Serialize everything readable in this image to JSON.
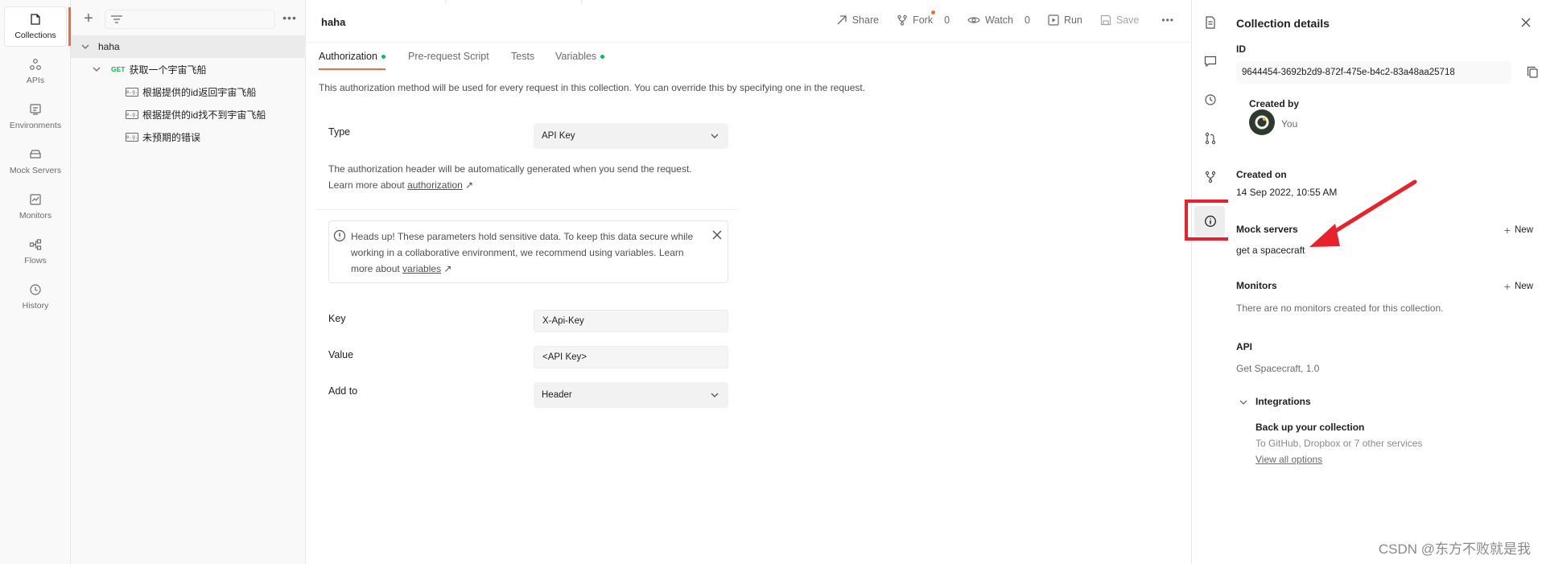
{
  "rail": {
    "items": [
      {
        "label": "Collections",
        "icon": "collections-icon"
      },
      {
        "label": "APIs",
        "icon": "apis-icon"
      },
      {
        "label": "Environments",
        "icon": "environments-icon"
      },
      {
        "label": "Mock Servers",
        "icon": "mock-servers-icon"
      },
      {
        "label": "Monitors",
        "icon": "monitors-icon"
      },
      {
        "label": "Flows",
        "icon": "flows-icon"
      },
      {
        "label": "History",
        "icon": "history-icon"
      }
    ]
  },
  "sidebar": {
    "collection": "haha",
    "request": {
      "method": "GET",
      "name": "获取一个宇宙飞船"
    },
    "examples": [
      "根据提供的id返回宇宙飞船",
      "根据提供的id找不到宇宙飞船",
      "未预期的错误"
    ]
  },
  "header": {
    "title": "haha",
    "share": "Share",
    "fork": "Fork",
    "fork_count": "0",
    "watch": "Watch",
    "watch_count": "0",
    "run": "Run",
    "save": "Save"
  },
  "tabs": [
    {
      "label": "Authorization",
      "dot": true
    },
    {
      "label": "Pre-request Script",
      "dot": false
    },
    {
      "label": "Tests",
      "dot": false
    },
    {
      "label": "Variables",
      "dot": true
    }
  ],
  "auth": {
    "description": "This authorization method will be used for every request in this collection. You can override this by specifying one in the request.",
    "type_label": "Type",
    "type_value": "API Key",
    "helper_text": "The authorization header will be automatically generated when you send the request. Learn more about",
    "helper_link": "authorization",
    "alert_text": "Heads up! These parameters hold sensitive data. To keep this data secure while working in a collaborative environment, we recommend using variables. Learn more about",
    "alert_link": "variables",
    "key_label": "Key",
    "key_value": "X-Api-Key",
    "value_label": "Value",
    "value_value": "<API Key>",
    "addto_label": "Add to",
    "addto_value": "Header"
  },
  "details": {
    "title": "Collection details",
    "id_label": "ID",
    "id_value": "9644454-3692b2d9-872f-475e-b4c2-83a48aa25718",
    "created_by_label": "Created by",
    "created_by_value": "You",
    "created_on_label": "Created on",
    "created_on_value": "14 Sep 2022, 10:55 AM",
    "mock_label": "Mock servers",
    "mock_new": "New",
    "mock_value": "get a spacecraft",
    "monitors_label": "Monitors",
    "monitors_new": "New",
    "monitors_empty": "There are no monitors created for this collection.",
    "api_label": "API",
    "api_value": "Get Spacecraft, 1.0",
    "integrations_label": "Integrations",
    "backup_title": "Back up your collection",
    "backup_desc": "To GitHub, Dropbox or 7 other services",
    "backup_link": "View all options"
  },
  "watermark": "CSDN @东方不败就是我",
  "colors": {
    "accent": "#f26b3a",
    "green": "#0cbb52",
    "highlight": "#e8222b"
  }
}
